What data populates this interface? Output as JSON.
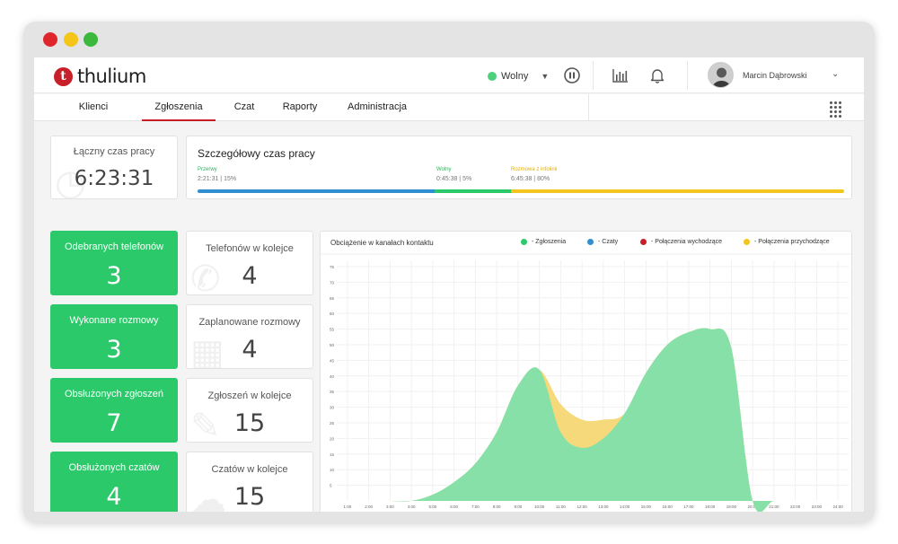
{
  "window": {
    "controls": [
      "close",
      "minimize",
      "maximize"
    ],
    "control_colors": [
      "#e0262d",
      "#f5c518",
      "#3cb93c"
    ]
  },
  "header": {
    "logo_mark": "t",
    "logo_text": "thulium",
    "status_label": "Wolny",
    "status_color": "#4cd07a",
    "icons": [
      "pause-icon",
      "bar-chart-icon",
      "bell-icon",
      "apps-grid-icon"
    ],
    "user_name": "Marcin Dąbrowski"
  },
  "nav": {
    "tabs": [
      {
        "label": "Klienci",
        "active": false
      },
      {
        "label": "Zgłoszenia",
        "active": true
      },
      {
        "label": "Czat",
        "active": false
      },
      {
        "label": "Raporty",
        "active": false
      },
      {
        "label": "Administracja",
        "active": false
      }
    ]
  },
  "work_time": {
    "title": "Łączny czas pracy",
    "value": "6:23:31"
  },
  "detail": {
    "title": "Szczegółowy czas pracy",
    "segments": [
      {
        "label": "Przerwy",
        "value": "2:21:31 | 15%",
        "color": "#2f8fd0"
      },
      {
        "label": "Wolny",
        "value": "0:45:38 | 5%",
        "color": "#2cc96b"
      },
      {
        "label": "Rozmowa z infolinii",
        "value": "6:45:38 | 80%",
        "color": "#f2c51f"
      }
    ]
  },
  "stats_green": [
    {
      "title": "Odebranych telefonów",
      "value": "3"
    },
    {
      "title": "Wykonane rozmowy",
      "value": "3"
    },
    {
      "title": "Obsłużonych zgłoszeń",
      "value": "7"
    },
    {
      "title": "Obsłużonych czatów",
      "value": "4"
    }
  ],
  "stats_white": [
    {
      "title": "Telefonów w kolejce",
      "value": "4"
    },
    {
      "title": "Zaplanowane rozmowy",
      "value": "4"
    },
    {
      "title": "Zgłoszeń w kolejce",
      "value": "15"
    },
    {
      "title": "Czatów w kolejce",
      "value": "15"
    }
  ],
  "chart_data": {
    "type": "area",
    "title": "Obciążenie w kanałach kontaktu",
    "legend": [
      {
        "name": "- Zgłoszenia",
        "color": "#2cc96b"
      },
      {
        "name": "- Czaty",
        "color": "#2f8fd0"
      },
      {
        "name": "- Połączenia wychodzące",
        "color": "#c8202b"
      },
      {
        "name": "- Połączenia przychodzące",
        "color": "#f2c51f"
      }
    ],
    "x": [
      "1:00",
      "2:00",
      "3:00",
      "4:00",
      "5:00",
      "6:00",
      "7:00",
      "8:00",
      "9:00",
      "10:00",
      "11:00",
      "12:00",
      "13:00",
      "14:00",
      "15:00",
      "16:00",
      "17:00",
      "18:00",
      "19:00",
      "20:00",
      "21:00",
      "22:00",
      "23:00",
      "24:00"
    ],
    "y_ticks": [
      5,
      10,
      15,
      20,
      25,
      30,
      35,
      40,
      45,
      50,
      55,
      60,
      65,
      70,
      75
    ],
    "ylim": [
      0,
      77
    ],
    "series": [
      {
        "name": "- Zgłoszenia",
        "color": "#86e0a8",
        "values": [
          0,
          0,
          0,
          0,
          2,
          6,
          12,
          22,
          37,
          42,
          22,
          17,
          20,
          28,
          41,
          50,
          54,
          55,
          49,
          0,
          0,
          0,
          0,
          0
        ]
      },
      {
        "name": "- Połączenia przychodzące",
        "color": "#f5d97a",
        "values": [
          0,
          0,
          0,
          0,
          0,
          0,
          0,
          0,
          0,
          0,
          9,
          9,
          6,
          0,
          0,
          0,
          0,
          0,
          0,
          0,
          0,
          0,
          0,
          0
        ]
      }
    ],
    "grid": true
  }
}
